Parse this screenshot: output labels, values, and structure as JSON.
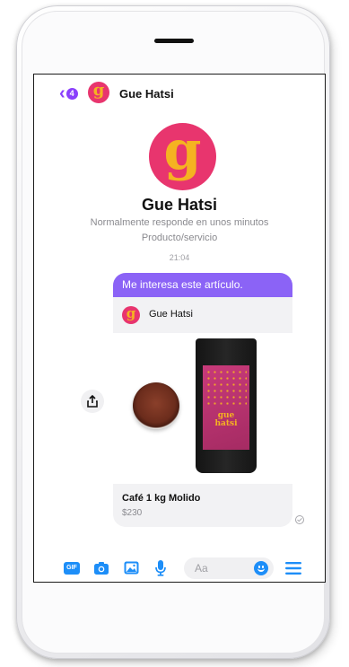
{
  "header": {
    "back_badge_count": "4",
    "contact_name": "Gue Hatsi"
  },
  "profile": {
    "name": "Gue Hatsi",
    "response_time": "Normalmente responde en unos minutos",
    "category": "Producto/servicio"
  },
  "conversation": {
    "timestamp": "21:04",
    "message_text": "Me interesa este artículo.",
    "product": {
      "seller_name": "Gue Hatsi",
      "name": "Café 1 kg Molido",
      "price": "$230"
    }
  },
  "composer": {
    "input_placeholder": "Aa",
    "buttons": [
      "gif-icon",
      "camera-icon",
      "image-icon",
      "microphone-icon",
      "emoji-icon",
      "menu-icon"
    ]
  },
  "colors": {
    "accent": "#8a3ffc",
    "message_bubble": "#8b63f6",
    "brand_pink": "#e8356e",
    "brand_yellow": "#f5b321",
    "icon_blue": "#1d8ef8"
  }
}
